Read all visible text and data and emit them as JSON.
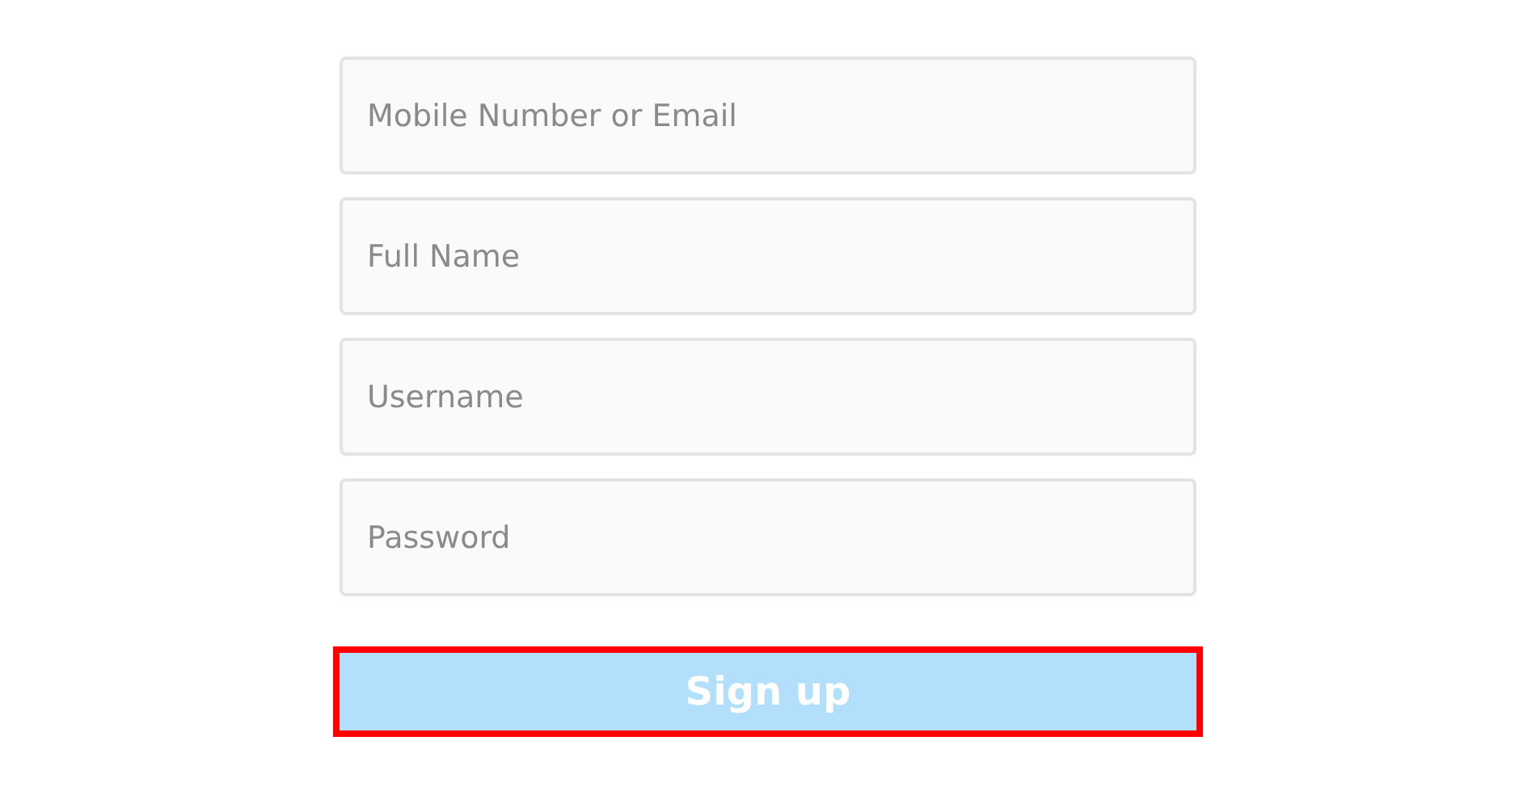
{
  "fields": [
    {
      "placeholder": "Mobile Number or Email"
    },
    {
      "placeholder": "Full Name"
    },
    {
      "placeholder": "Username"
    },
    {
      "placeholder": "Password"
    }
  ],
  "signup_button": {
    "label": "Sign up",
    "disabled": true,
    "highlighted": true
  }
}
